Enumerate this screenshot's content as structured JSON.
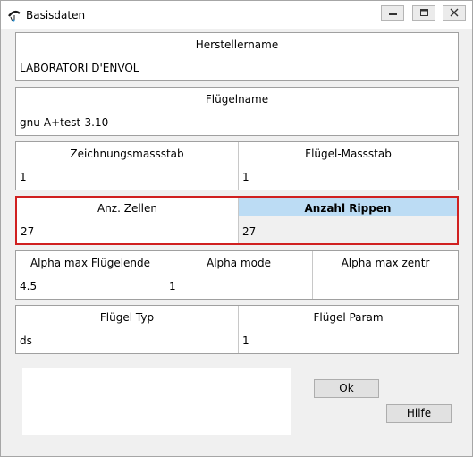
{
  "window": {
    "title": "Basisdaten"
  },
  "fields": {
    "herstellername": {
      "label": "Herstellername",
      "value": "LABORATORI D'ENVOL"
    },
    "fluegelname": {
      "label": "Flügelname",
      "value": "gnu-A+test-3.10"
    },
    "zeichnungsmassstab": {
      "label": "Zeichnungsmassstab",
      "value": "1"
    },
    "fluegel_massstab": {
      "label": "Flügel-Massstab",
      "value": "1"
    },
    "anz_zellen": {
      "label": "Anz. Zellen",
      "value": "27"
    },
    "anzahl_rippen": {
      "label": "Anzahl Rippen",
      "value": "27"
    },
    "alpha_max_fluegelende": {
      "label": "Alpha max Flügelende",
      "value": "4.5"
    },
    "alpha_mode": {
      "label": "Alpha mode",
      "value": "1"
    },
    "alpha_max_zentr": {
      "label": "Alpha max zentr",
      "value": ""
    },
    "fluegel_typ": {
      "label": "Flügel Typ",
      "value": "ds"
    },
    "fluegel_param": {
      "label": "Flügel Param",
      "value": "1"
    }
  },
  "buttons": {
    "ok": "Ok",
    "hilfe": "Hilfe"
  },
  "colors": {
    "highlight_border": "#d02020",
    "selected_header": "#bcdcf4",
    "window_background": "#f0f0f0"
  }
}
